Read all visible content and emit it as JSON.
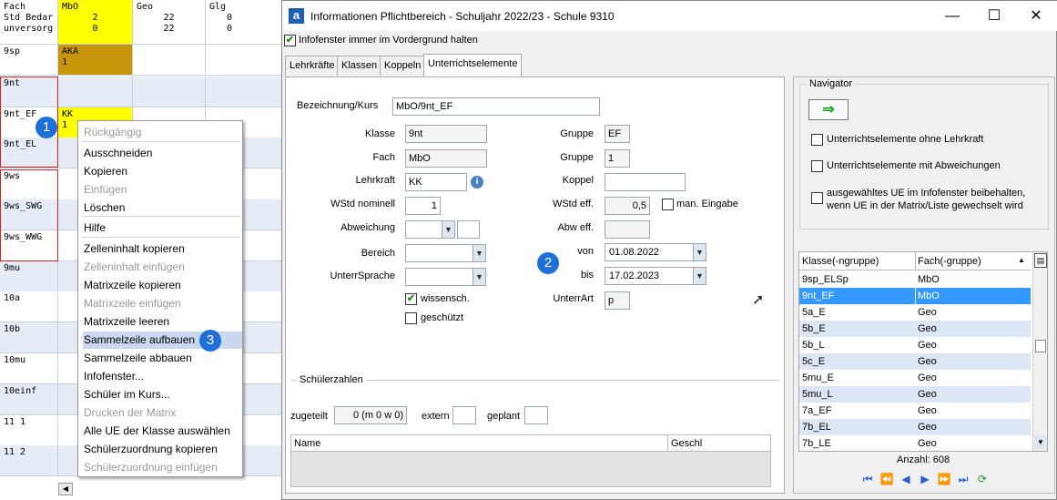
{
  "matrix": {
    "header": {
      "col1": [
        "Fach",
        "Std Bedar",
        "unversorg"
      ],
      "mbo": [
        "MbO",
        "2",
        "0"
      ],
      "geo": [
        "Geo",
        "22",
        "22"
      ],
      "glg": [
        "Glg",
        "0",
        "0"
      ]
    },
    "rows": [
      {
        "klasse": "9sp",
        "mbo": "AKA\n1"
      },
      {
        "klasse": "9nt",
        "mbo": ""
      },
      {
        "klasse": "9nt_EF",
        "mbo": "KK\n1"
      },
      {
        "klasse": "9nt_EL",
        "mbo": ""
      },
      {
        "klasse": "9ws",
        "mbo": ""
      },
      {
        "klasse": "9ws_SWG",
        "mbo": ""
      },
      {
        "klasse": "9ws_WWG",
        "mbo": ""
      },
      {
        "klasse": "9mu",
        "mbo": ""
      },
      {
        "klasse": "10a",
        "mbo": ""
      },
      {
        "klasse": "10b",
        "mbo": ""
      },
      {
        "klasse": "10mu",
        "mbo": ""
      },
      {
        "klasse": "10einf",
        "mbo": ""
      },
      {
        "klasse": "11 1",
        "mbo": ""
      },
      {
        "klasse": "11 2",
        "mbo": ""
      }
    ],
    "scroll_left": "◀"
  },
  "context_menu": {
    "items": [
      {
        "label": "Rückgängig",
        "disabled": true
      },
      {
        "label": "Ausschneiden",
        "disabled": false
      },
      {
        "label": "Kopieren",
        "disabled": false
      },
      {
        "label": "Einfügen",
        "disabled": true
      },
      {
        "label": "Löschen",
        "disabled": false
      },
      {
        "label": "Hilfe",
        "disabled": false
      },
      {
        "label": "Zelleninhalt kopieren",
        "disabled": false
      },
      {
        "label": "Zelleninhalt einfügen",
        "disabled": true
      },
      {
        "label": "Matrixzeile kopieren",
        "disabled": false
      },
      {
        "label": "Matrixzeile einfügen",
        "disabled": true
      },
      {
        "label": "Matrixzeile leeren",
        "disabled": false
      },
      {
        "label": "Sammelzeile aufbauen",
        "disabled": false,
        "highlighted": true
      },
      {
        "label": "Sammelzeile abbauen",
        "disabled": false
      },
      {
        "label": "Infofenster...",
        "disabled": false
      },
      {
        "label": "Schüler im Kurs...",
        "disabled": false
      },
      {
        "label": "Drucken der Matrix",
        "disabled": true
      },
      {
        "label": "Alle UE der Klasse auswählen",
        "disabled": false
      },
      {
        "label": "Schülerzuordnung kopieren",
        "disabled": false
      },
      {
        "label": "Schülerzuordnung einfügen",
        "disabled": true
      }
    ]
  },
  "badges": {
    "b1": "1",
    "b2": "2",
    "b3": "3"
  },
  "window": {
    "icon_letter": "a",
    "title": "Informationen Pflichtbereich - Schuljahr 2022/23 - Schule 9310",
    "minimize": "—",
    "maximize": "☐",
    "close": "✕",
    "foreground_label": "Infofenster immer im Vordergrund halten",
    "tabs": [
      "Lehrkräfte",
      "Klassen",
      "Koppeln",
      "Unterrichtselemente"
    ],
    "form": {
      "bezeichnung_label": "Bezeichnung/Kurs",
      "bezeichnung_value": "MbO/9nt_EF",
      "klasse_label": "Klasse",
      "klasse_value": "9nt",
      "fach_label": "Fach",
      "fach_value": "MbO",
      "lehrkraft_label": "Lehrkraft",
      "lehrkraft_value": "KK",
      "wstd_nominell_label": "WStd nominell",
      "wstd_nominell_value": "1",
      "abweichung_label": "Abweichung",
      "bereich_label": "Bereich",
      "unterrsprache_label": "UnterrSprache",
      "wissensch_label": "wissensch.",
      "geschuetzt_label": "geschützt",
      "gruppe1_label": "Gruppe",
      "gruppe1_value": "EF",
      "gruppe2_label": "Gruppe",
      "gruppe2_value": "1",
      "koppel_label": "Koppel",
      "koppel_value": "",
      "wstd_eff_label": "WStd eff.",
      "wstd_eff_value": "0,5",
      "man_eingabe_label": "man. Eingabe",
      "abw_eff_label": "Abw eff.",
      "von_label": "von",
      "von_value": "01.08.2022",
      "bis_label": "bis",
      "bis_value": "17.02.2023",
      "unterrart_label": "UnterrArt",
      "unterrart_value": "p"
    },
    "schuelerzahlen": {
      "section_label": "Schülerzahlen",
      "zugeteilt_label": "zugeteilt",
      "zugeteilt_value": "0 (m 0 w 0)",
      "extern_label": "extern",
      "geplant_label": "geplant",
      "col_name": "Name",
      "col_geschl": "Geschl"
    },
    "navigator": {
      "label": "Navigator",
      "arrow": "⇒",
      "opt1": "Unterrichtselemente ohne Lehrkraft",
      "opt2": "Unterrichtselemente mit Abweichungen",
      "opt3": "ausgewähltes UE im Infofenster beibehalten, wenn UE in der Matrix/Liste gewechselt wird",
      "col_klasse": "Klasse(-ngruppe)",
      "col_fach": "Fach(-gruppe)",
      "rows": [
        {
          "klasse": "9sp_ELSp",
          "fach": "MbO"
        },
        {
          "klasse": "9nt_EF",
          "fach": "MbO",
          "selected": true
        },
        {
          "klasse": "5a_E",
          "fach": "Geo"
        },
        {
          "klasse": "5b_E",
          "fach": "Geo"
        },
        {
          "klasse": "5b_L",
          "fach": "Geo"
        },
        {
          "klasse": "5c_E",
          "fach": "Geo"
        },
        {
          "klasse": "5mu_E",
          "fach": "Geo"
        },
        {
          "klasse": "5mu_L",
          "fach": "Geo"
        },
        {
          "klasse": "7a_EF",
          "fach": "Geo"
        },
        {
          "klasse": "7b_EL",
          "fach": "Geo"
        },
        {
          "klasse": "7b_LE",
          "fach": "Geo"
        }
      ],
      "count": "Anzahl: 608",
      "nav_buttons": [
        "⏮",
        "⏪",
        "◀",
        "▶",
        "⏩",
        "⏭",
        "⟳"
      ]
    }
  },
  "colors": {
    "yellow": "#ffff00",
    "brown": "#c8960a",
    "selected": "#3399ff",
    "lightblue": "#dce6f4",
    "badge": "#1e6fd8"
  }
}
